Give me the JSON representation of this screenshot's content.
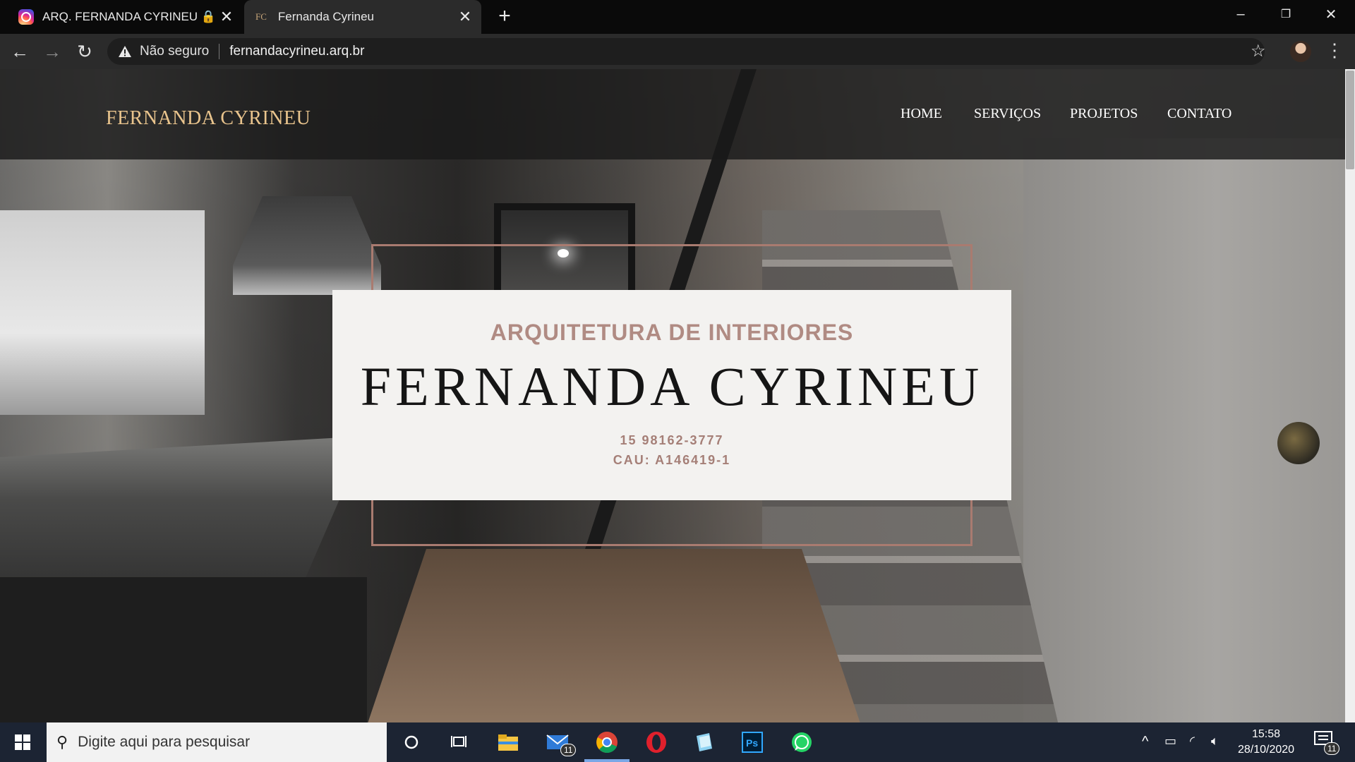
{
  "browser": {
    "tabs": [
      {
        "title": "ARQ. FERNANDA CYRINEU 🔒 (@",
        "favicon": "instagram-icon",
        "active": false
      },
      {
        "title": "Fernanda Cyrineu",
        "favicon_text": "FC",
        "active": true
      }
    ],
    "address": {
      "security_label": "Não seguro",
      "url": "fernandacyrineu.arq.br"
    },
    "window_controls": {
      "minimize": "–",
      "restore": "❐",
      "close": "✕"
    }
  },
  "site": {
    "logo": "FERNANDA CYRINEU",
    "nav": [
      "HOME",
      "SERVIÇOS",
      "PROJETOS",
      "CONTATO"
    ],
    "hero": {
      "eyebrow": "ARQUITETURA DE INTERIORES",
      "name": "FERNANDA CYRINEU",
      "phone": "15 98162-3777",
      "registration": "CAU: A146419-1"
    },
    "colors": {
      "logo": "#e9c48d",
      "accent": "#a97b70",
      "card_bg": "#f3f2f0"
    }
  },
  "taskbar": {
    "search_placeholder": "Digite aqui para pesquisar",
    "mail_badge": "11",
    "clock_time": "15:58",
    "clock_date": "28/10/2020",
    "notification_badge": "11",
    "apps": [
      "cortana-icon",
      "task-view-icon",
      "file-explorer-icon",
      "mail-icon",
      "chrome-icon",
      "opera-icon",
      "notepad-icon",
      "photoshop-icon",
      "whatsapp-icon"
    ]
  }
}
